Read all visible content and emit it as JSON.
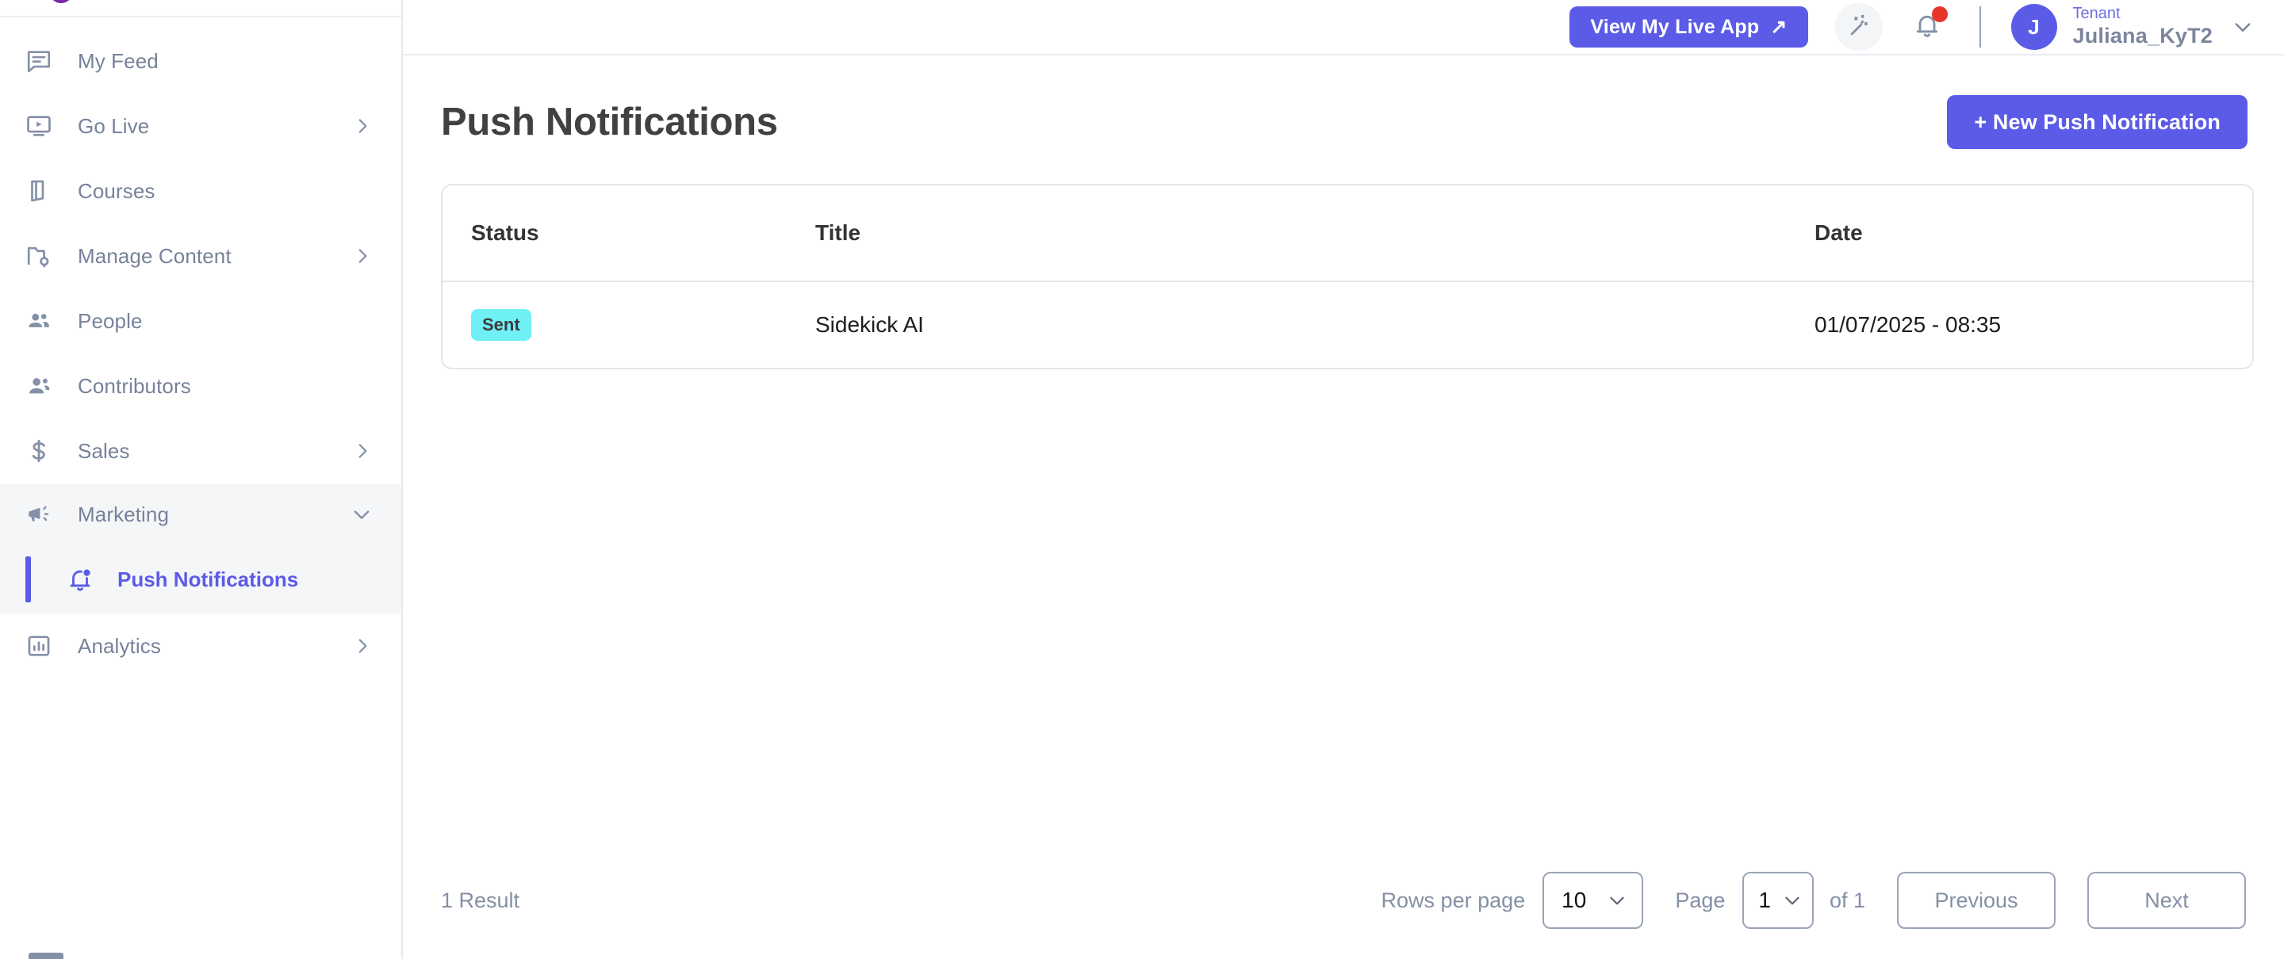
{
  "sidebar": {
    "items": [
      {
        "label": "My Feed",
        "icon": "feed-icon",
        "expandable": false
      },
      {
        "label": "Go Live",
        "icon": "live-video-icon",
        "expandable": true
      },
      {
        "label": "Courses",
        "icon": "book-icon",
        "expandable": false
      },
      {
        "label": "Manage Content",
        "icon": "folder-gear-icon",
        "expandable": true
      },
      {
        "label": "People",
        "icon": "people-icon",
        "expandable": false
      },
      {
        "label": "Contributors",
        "icon": "contributors-icon",
        "expandable": false
      },
      {
        "label": "Sales",
        "icon": "dollar-icon",
        "expandable": true
      }
    ],
    "marketing": {
      "label": "Marketing",
      "icon": "megaphone-icon",
      "expanded": true,
      "children": [
        {
          "label": "Push Notifications",
          "icon": "bell-alert-icon",
          "active": true
        }
      ]
    },
    "analytics": {
      "label": "Analytics",
      "icon": "bar-chart-icon",
      "expandable": true
    },
    "active_color": "#5b5be8",
    "muted_color": "#77829a"
  },
  "topbar": {
    "live_app_button": "View My Live App",
    "live_app_arrow": "↗",
    "magic_icon": "magic-wand-icon",
    "bell_icon": "bell-icon",
    "has_notification": true,
    "tenant_label": "Tenant",
    "tenant_name": "Juliana_KyT2",
    "avatar_initial": "J",
    "accent": "#5b5be8"
  },
  "page": {
    "title": "Push Notifications",
    "new_button": "+ New Push Notification"
  },
  "table": {
    "columns": [
      "Status",
      "Title",
      "Date"
    ],
    "rows": [
      {
        "status": "Sent",
        "title": "Sidekick AI",
        "date": "01/07/2025 - 08:35"
      }
    ],
    "status_badge_color": "#6ff0f5"
  },
  "footer": {
    "result_count": "1 Result",
    "rows_per_page_label": "Rows per page",
    "rows_per_page_value": "10",
    "page_label": "Page",
    "page_value": "1",
    "of_text": "of 1",
    "previous_button": "Previous",
    "next_button": "Next"
  }
}
